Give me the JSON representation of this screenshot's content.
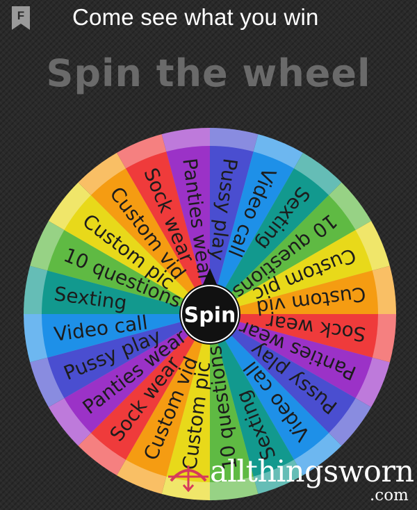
{
  "header": {
    "badge_letter": "F",
    "title": "Come see what you win"
  },
  "page": {
    "title": "Spin the wheel"
  },
  "wheel": {
    "spin_label": "Spin",
    "segments": [
      {
        "label": "Pussy play",
        "color": "#4a4ed0"
      },
      {
        "label": "Video call",
        "color": "#1e90e8"
      },
      {
        "label": "Sexting",
        "color": "#12998e"
      },
      {
        "label": "10 questions",
        "color": "#5fba43"
      },
      {
        "label": "Custom pic",
        "color": "#e8d91a"
      },
      {
        "label": "Custom vid",
        "color": "#f59c12"
      },
      {
        "label": "Sock wear",
        "color": "#ef3b3b"
      },
      {
        "label": "Panties wear",
        "color": "#9b32c7"
      },
      {
        "label": "Pussy play",
        "color": "#4a4ed0"
      },
      {
        "label": "Video call",
        "color": "#1e90e8"
      },
      {
        "label": "Sexting",
        "color": "#12998e"
      },
      {
        "label": "10 questions",
        "color": "#5fba43"
      },
      {
        "label": "Custom pic",
        "color": "#e8d91a"
      },
      {
        "label": "Custom vid",
        "color": "#f59c12"
      },
      {
        "label": "Sock wear",
        "color": "#ef3b3b"
      },
      {
        "label": "Panties wear",
        "color": "#9b32c7"
      },
      {
        "label": "Pussy play",
        "color": "#4a4ed0"
      },
      {
        "label": "Video call",
        "color": "#1e90e8"
      },
      {
        "label": "Sexting",
        "color": "#12998e"
      },
      {
        "label": "10 questions",
        "color": "#5fba43"
      },
      {
        "label": "Custom pic",
        "color": "#e8d91a"
      },
      {
        "label": "Custom vid",
        "color": "#f59c12"
      },
      {
        "label": "Sock wear",
        "color": "#ef3b3b"
      },
      {
        "label": "Panties wear",
        "color": "#9b32c7"
      }
    ]
  },
  "watermark": {
    "text": "allthingsworn",
    "suffix": ".com"
  }
}
